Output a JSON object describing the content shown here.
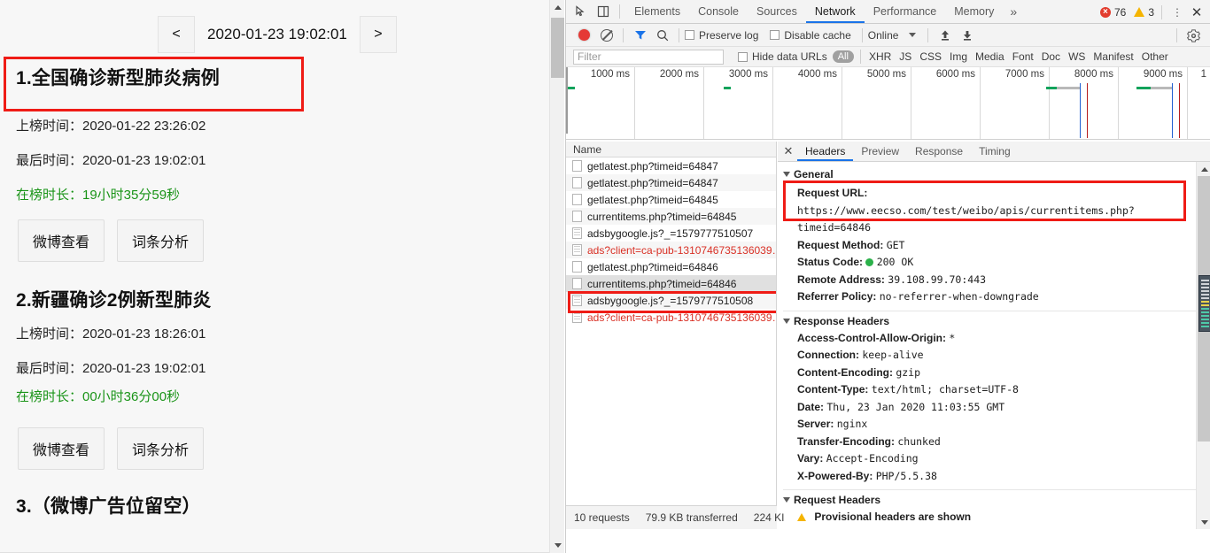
{
  "webpage": {
    "pager": {
      "prev": "<",
      "next": ">",
      "datetime": "2020-01-23 19:02:01"
    },
    "items": [
      {
        "title": "1.全国确诊新型肺炎病例",
        "listed_time": "上榜时间：2020-01-22 23:26:02",
        "last_time": "最后时间：2020-01-23 19:02:01",
        "duration": "在榜时长：19小时35分59秒",
        "btn_weibo": "微博查看",
        "btn_analysis": "词条分析"
      },
      {
        "title": "2.新疆确诊2例新型肺炎",
        "listed_time": "上榜时间：2020-01-23 18:26:01",
        "last_time": "最后时间：2020-01-23 19:02:01",
        "duration": "在榜时长：00小时36分00秒",
        "btn_weibo": "微博查看",
        "btn_analysis": "词条分析"
      },
      {
        "title": "3.（微博广告位留空）"
      }
    ]
  },
  "devtools": {
    "tabs": [
      {
        "label": "Elements",
        "active": false
      },
      {
        "label": "Console",
        "active": false
      },
      {
        "label": "Sources",
        "active": false
      },
      {
        "label": "Network",
        "active": true
      },
      {
        "label": "Performance",
        "active": false
      },
      {
        "label": "Memory",
        "active": false
      }
    ],
    "more_tabs": "»",
    "errors": "76",
    "warnings": "3",
    "network_toolbar": {
      "preserve_log": "Preserve log",
      "disable_cache": "Disable cache",
      "throttling": "Online"
    },
    "filter_bar": {
      "placeholder": "Filter",
      "hide_data_urls": "Hide data URLs",
      "types": [
        "All",
        "XHR",
        "JS",
        "CSS",
        "Img",
        "Media",
        "Font",
        "Doc",
        "WS",
        "Manifest",
        "Other"
      ]
    },
    "overview": {
      "ticks": [
        "1000 ms",
        "2000 ms",
        "3000 ms",
        "4000 ms",
        "5000 ms",
        "6000 ms",
        "7000 ms",
        "8000 ms",
        "9000 ms",
        "1"
      ]
    },
    "request_list": {
      "header": "Name",
      "rows": [
        {
          "name": "getlatest.php?timeid=64847",
          "icon": "doc-icon",
          "error": false,
          "selected": false
        },
        {
          "name": "getlatest.php?timeid=64847",
          "icon": "doc-icon",
          "error": false,
          "selected": false
        },
        {
          "name": "getlatest.php?timeid=64845",
          "icon": "doc-icon",
          "error": false,
          "selected": false
        },
        {
          "name": "currentitems.php?timeid=64845",
          "icon": "doc-icon",
          "error": false,
          "selected": false
        },
        {
          "name": "adsbygoogle.js?_=1579777510507",
          "icon": "js-icon",
          "error": false,
          "selected": false
        },
        {
          "name": "ads?client=ca-pub-1310746735136039…",
          "icon": "js-icon",
          "error": true,
          "selected": false
        },
        {
          "name": "getlatest.php?timeid=64846",
          "icon": "doc-icon",
          "error": false,
          "selected": false
        },
        {
          "name": "currentitems.php?timeid=64846",
          "icon": "doc-icon",
          "error": false,
          "selected": true
        },
        {
          "name": "adsbygoogle.js?_=1579777510508",
          "icon": "js-icon",
          "error": false,
          "selected": false
        },
        {
          "name": "ads?client=ca-pub-1310746735136039…",
          "icon": "js-icon",
          "error": true,
          "selected": false
        }
      ]
    },
    "status_bar": {
      "requests": "10 requests",
      "transferred": "79.9 KB transferred",
      "resources": "224 KI"
    },
    "details": {
      "tabs": [
        {
          "label": "Headers",
          "active": true
        },
        {
          "label": "Preview",
          "active": false
        },
        {
          "label": "Response",
          "active": false
        },
        {
          "label": "Timing",
          "active": false
        }
      ],
      "general": {
        "title": "General",
        "request_url_key": "Request URL:",
        "request_url_value": "https://www.eecso.com/test/weibo/apis/currentitems.php?timeid=64846",
        "rows": [
          {
            "key": "Request Method:",
            "value": "GET"
          },
          {
            "key": "Status Code:",
            "value": "200 OK",
            "status_dot": true
          },
          {
            "key": "Remote Address:",
            "value": "39.108.99.70:443"
          },
          {
            "key": "Referrer Policy:",
            "value": "no-referrer-when-downgrade"
          }
        ]
      },
      "response_headers": {
        "title": "Response Headers",
        "rows": [
          {
            "key": "Access-Control-Allow-Origin:",
            "value": "*"
          },
          {
            "key": "Connection:",
            "value": "keep-alive"
          },
          {
            "key": "Content-Encoding:",
            "value": "gzip"
          },
          {
            "key": "Content-Type:",
            "value": "text/html; charset=UTF-8"
          },
          {
            "key": "Date:",
            "value": "Thu, 23 Jan 2020 11:03:55 GMT"
          },
          {
            "key": "Server:",
            "value": "nginx"
          },
          {
            "key": "Transfer-Encoding:",
            "value": "chunked"
          },
          {
            "key": "Vary:",
            "value": "Accept-Encoding"
          },
          {
            "key": "X-Powered-By:",
            "value": "PHP/5.5.38"
          }
        ]
      },
      "request_headers": {
        "title": "Request Headers",
        "provisional": "Provisional headers are shown"
      }
    }
  },
  "colors": {
    "highlight": "#ef1c16",
    "accent": "#1a73e8",
    "green_text": "#1a9418",
    "error_text": "#d93025"
  }
}
